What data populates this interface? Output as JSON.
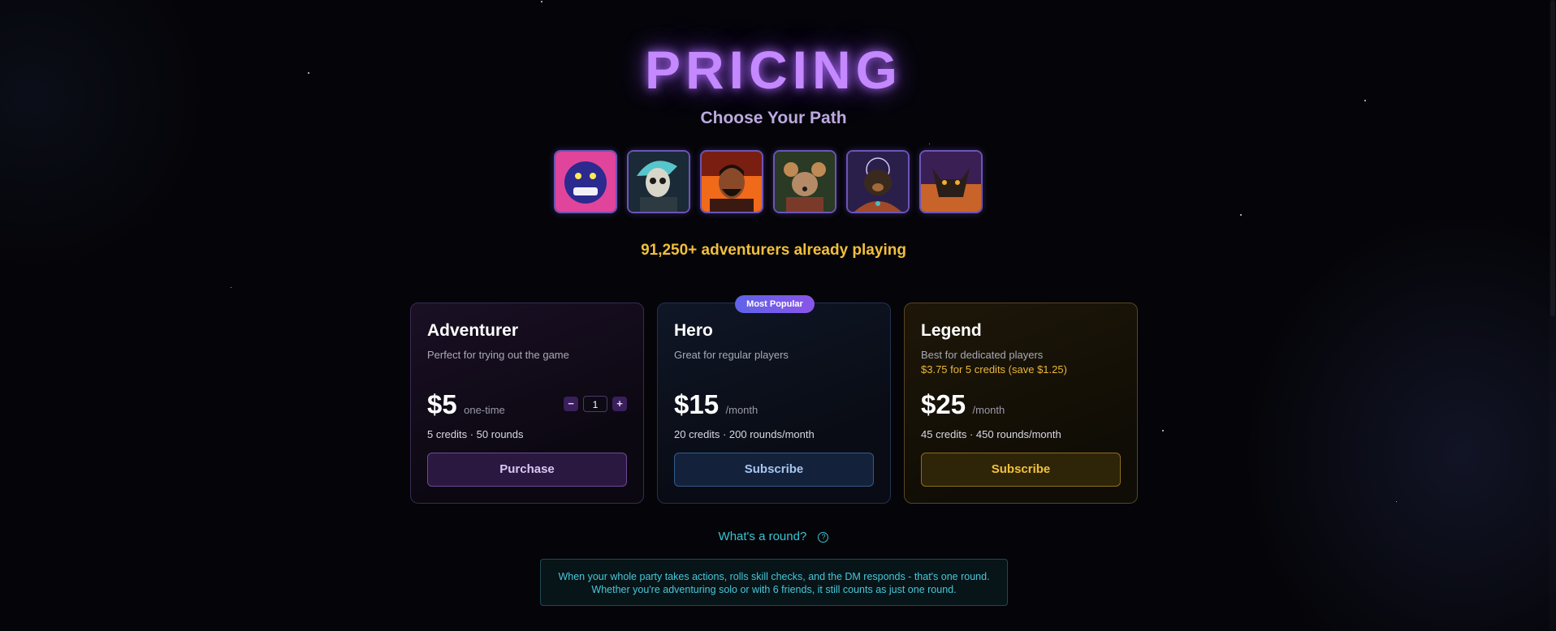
{
  "header": {
    "title": "PRICING",
    "subtitle": "Choose Your Path"
  },
  "avatars": [
    {
      "name": "blue-monster-avatar",
      "colors": [
        "#2c2a8e",
        "#e0459b"
      ]
    },
    {
      "name": "skeleton-knight-avatar",
      "colors": [
        "#25465a",
        "#7fd6d6"
      ]
    },
    {
      "name": "fire-warrior-avatar",
      "colors": [
        "#7a1e12",
        "#f06a1a"
      ]
    },
    {
      "name": "rat-rogue-avatar",
      "colors": [
        "#3a4a2a",
        "#c08a55"
      ]
    },
    {
      "name": "bear-monk-avatar",
      "colors": [
        "#2a1f4a",
        "#a06a3a"
      ]
    },
    {
      "name": "wolf-beast-avatar",
      "colors": [
        "#3a1f55",
        "#c8642a"
      ]
    }
  ],
  "social_proof": "91,250+ adventurers already playing",
  "plans": [
    {
      "name": "Adventurer",
      "description": "Perfect for trying out the game",
      "price": "$5",
      "period": "one-time",
      "quantity": "1",
      "qty_minus": "−",
      "qty_plus": "+",
      "meta": "5 credits · 50 rounds",
      "cta": "Purchase"
    },
    {
      "name": "Hero",
      "badge": "Most Popular",
      "description": "Great for regular players",
      "price": "$15",
      "period": "/month",
      "meta": "20 credits · 200 rounds/month",
      "cta": "Subscribe"
    },
    {
      "name": "Legend",
      "description": "Best for dedicated players",
      "savings": "$3.75 for 5 credits (save $1.25)",
      "price": "$25",
      "period": "/month",
      "meta": "45 credits · 450 rounds/month",
      "cta": "Subscribe"
    }
  ],
  "round_help": {
    "link": "What's a round?",
    "icon": "question-circle-icon",
    "icon_glyph": "?",
    "line1": "When your whole party takes actions, rolls skill checks, and the DM responds - that's one round.",
    "line2": "Whether you're adventuring solo or with 6 friends, it still counts as just one round."
  },
  "colors": {
    "title_glow": "#c488ff",
    "accent_gold": "#f2bf3c",
    "accent_cyan": "#38c4d4"
  }
}
